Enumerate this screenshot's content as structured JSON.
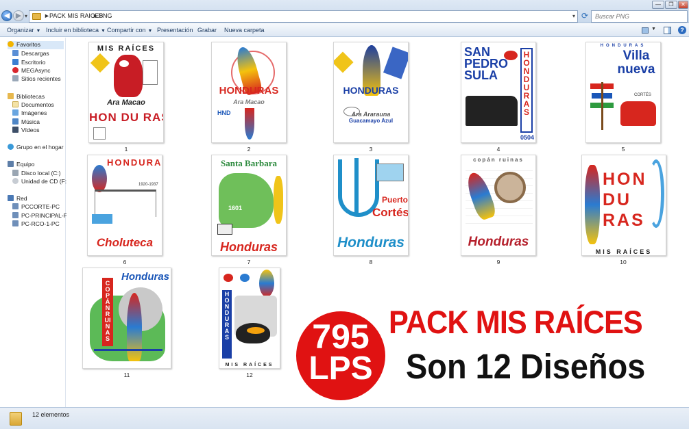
{
  "window": {
    "address": [
      "PACK MIS RAICES",
      "PNG"
    ],
    "search_placeholder": "Buscar PNG",
    "min": "—",
    "max": "❐",
    "close": "✕"
  },
  "toolbar": {
    "organize": "Organizar",
    "include": "Incluir en biblioteca",
    "share": "Compartir con",
    "present": "Presentación",
    "burn": "Grabar",
    "new_folder": "Nueva carpeta"
  },
  "nav": {
    "favorites": "Favoritos",
    "downloads": "Descargas",
    "desktop": "Escritorio",
    "mega": "MEGAsync",
    "recent": "Sitios recientes",
    "libraries": "Bibliotecas",
    "documents": "Documentos",
    "images": "Imágenes",
    "music": "Música",
    "videos": "Vídeos",
    "homegroup": "Grupo en el hogar",
    "computer": "Equipo",
    "disk_c": "Disco local (C:)",
    "disk_f": "Unidad de CD (F:)",
    "network": "Red",
    "pc1": "PCCORTE-PC",
    "pc2": "PC-PRINCIPAL-PC",
    "pc3": "PC-RCO-1-PC"
  },
  "files": [
    {
      "name": "1",
      "line1": "MIS RAÍCES",
      "line2": "Ara Macao",
      "line3": "HON DU RAS"
    },
    {
      "name": "2",
      "line1": "HONDURAS",
      "line2": "Ara Macao",
      "line3": "HND"
    },
    {
      "name": "3",
      "line1": "HONDURAS",
      "line2": "Ara Ararauna",
      "line3": "Guacamayo Azul"
    },
    {
      "name": "4",
      "line1": "SAN PEDRO SULA",
      "line2": "HONDURAS",
      "line3": "0504"
    },
    {
      "name": "5",
      "line1": "HONDURAS",
      "line2": "Villa nueva",
      "line3": "CORTÉS"
    },
    {
      "name": "6",
      "line1": "HONDURAS",
      "line2": "1920-1937",
      "line3": "Choluteca"
    },
    {
      "name": "7",
      "line1": "Santa Barbara",
      "line2": "1601",
      "line3": "Honduras"
    },
    {
      "name": "8",
      "line1": "Puerto",
      "line2": "Cortés",
      "line3": "Honduras"
    },
    {
      "name": "9",
      "line1": "copán ruinas",
      "line2": "",
      "line3": "Honduras"
    },
    {
      "name": "10",
      "line1": "HON DU RAS",
      "line2": "",
      "line3": "MIS RAÍCES"
    },
    {
      "name": "11",
      "line1": "Honduras",
      "line2": "COPÁN RUINAS",
      "line3": ""
    },
    {
      "name": "12",
      "line1": "HONDURAS",
      "line2": "",
      "line3": "MIS RAÍCES"
    }
  ],
  "promo": {
    "price": "795",
    "currency": "LPS",
    "title": "PACK MIS RAÍCES",
    "subtitle": "Son 12 Diseños"
  },
  "status": {
    "count": "12 elementos"
  },
  "colors": {
    "accent_red": "#e01212",
    "selection": "#d9e8f8"
  }
}
